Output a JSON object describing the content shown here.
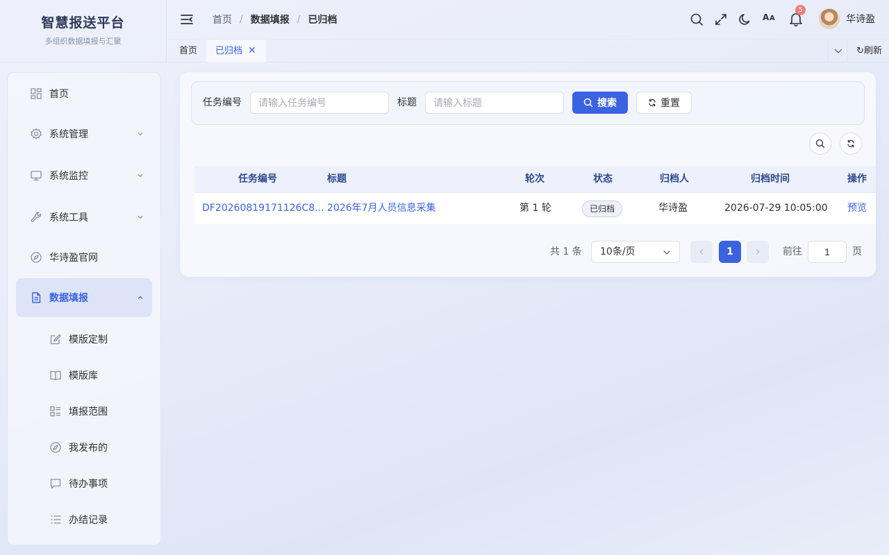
{
  "app": {
    "title": "智慧报送平台",
    "subtitle": "多组织数据填报与汇聚"
  },
  "breadcrumb": [
    "首页",
    "数据填报",
    "已归档"
  ],
  "header": {
    "notification_count": "5",
    "username": "华诗盈"
  },
  "tags": {
    "home": "首页",
    "active": "已归档",
    "close": "✕",
    "refresh": "刷新"
  },
  "sidebar": {
    "items": [
      {
        "label": "首页",
        "icon": "dashboard-icon"
      },
      {
        "label": "系统管理",
        "icon": "gear-icon"
      },
      {
        "label": "系统监控",
        "icon": "monitor-icon"
      },
      {
        "label": "系统工具",
        "icon": "wrench-icon"
      },
      {
        "label": "华诗盈官网",
        "icon": "compass-icon"
      },
      {
        "label": "数据填报",
        "icon": "document-icon"
      }
    ],
    "sub_items": [
      {
        "label": "模版定制",
        "icon": "edit-icon"
      },
      {
        "label": "模版库",
        "icon": "book-icon"
      },
      {
        "label": "填报范围",
        "icon": "list-grid-icon"
      },
      {
        "label": "我发布的",
        "icon": "compass-icon"
      },
      {
        "label": "待办事项",
        "icon": "chat-icon"
      },
      {
        "label": "办结记录",
        "icon": "list-icon"
      }
    ]
  },
  "search": {
    "task_label": "任务编号",
    "task_placeholder": "请输入任务编号",
    "title_label": "标题",
    "title_placeholder": "请输入标题",
    "search_button": "搜索",
    "reset_button": "重置"
  },
  "table": {
    "columns": [
      "任务编号",
      "标题",
      "轮次",
      "状态",
      "归档人",
      "归档时间",
      "操作"
    ],
    "rows": [
      {
        "task_no": "DF20260819171126C8...",
        "title": "2026年7月人员信息采集",
        "round": "第 1 轮",
        "status": "已归档",
        "archiver": "华诗盈",
        "archive_time": "2026-07-29 10:05:00",
        "action": "预览"
      }
    ]
  },
  "pagination": {
    "total": "共 1 条",
    "page_size": "10条/页",
    "current_page": "1",
    "goto_label": "前往",
    "goto_value": "1",
    "page_suffix": "页"
  },
  "colors": {
    "accent": "#3b63e0",
    "badge": "#f07c74",
    "header_text": "#2e4a8e"
  }
}
